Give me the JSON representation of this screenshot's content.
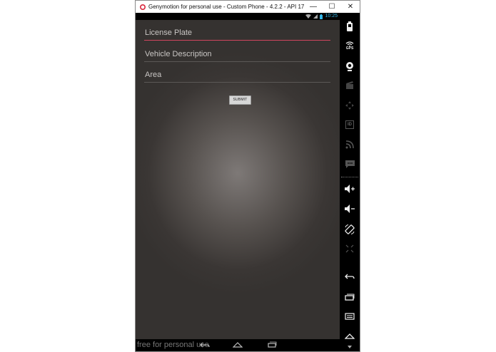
{
  "window": {
    "title": "Genymotion for personal use - Custom Phone - 4.2.2 - API 17 - 768x1...",
    "minimize_glyph": "—",
    "maximize_glyph": "☐",
    "close_glyph": "✕"
  },
  "statusbar": {
    "time": "10:25"
  },
  "form": {
    "fields": [
      {
        "label": "License Plate"
      },
      {
        "label": "Vehicle Description"
      },
      {
        "label": "Area"
      }
    ],
    "submit_label": "SUBMIT"
  },
  "navbar": {
    "watermark": "free for personal use"
  },
  "sidebar": {
    "gps_label": "GPS",
    "id_label": "ID"
  },
  "colors": {
    "accent_underline": "#d0455f",
    "clock": "#33b5e5",
    "screen_center": "#7e7977",
    "screen_edge": "#353230"
  }
}
